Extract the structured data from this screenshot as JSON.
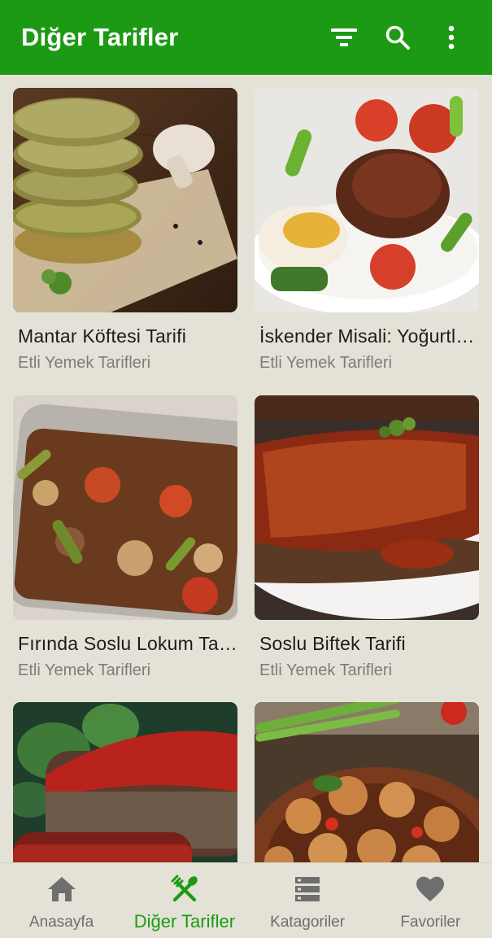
{
  "appbar": {
    "title": "Diğer Tarifler",
    "actions": [
      "filter-icon",
      "search-icon",
      "more-vert-icon"
    ],
    "color": "#1d9a15"
  },
  "recipes": [
    {
      "title": "Mantar Köftesi Tarifi",
      "category": "Etli Yemek Tarifleri",
      "image": "mushroom-patties"
    },
    {
      "title": "İskender Misali: Yoğurtlu Kebap",
      "category": "Etli Yemek Tarifleri",
      "image": "iskender-plate"
    },
    {
      "title": "Fırında Soslu Lokum Tarifi",
      "category": "Etli Yemek Tarifleri",
      "image": "baked-meat-tray"
    },
    {
      "title": "Soslu Biftek Tarifi",
      "category": "Etli Yemek Tarifleri",
      "image": "sauced-steak"
    },
    {
      "title": "",
      "category": "",
      "image": "meatloaf"
    },
    {
      "title": "",
      "category": "",
      "image": "meatballs-pan"
    }
  ],
  "bottom_nav": {
    "items": [
      {
        "label": "Anasayfa",
        "icon": "home-icon",
        "active": false
      },
      {
        "label": "Diğer Tarifler",
        "icon": "fork-knife-icon",
        "active": true
      },
      {
        "label": "Katagoriler",
        "icon": "storage-icon",
        "active": false
      },
      {
        "label": "Favoriler",
        "icon": "heart-icon",
        "active": false
      }
    ],
    "active_color": "#1d9a15",
    "inactive_color": "#6e6e6e"
  }
}
